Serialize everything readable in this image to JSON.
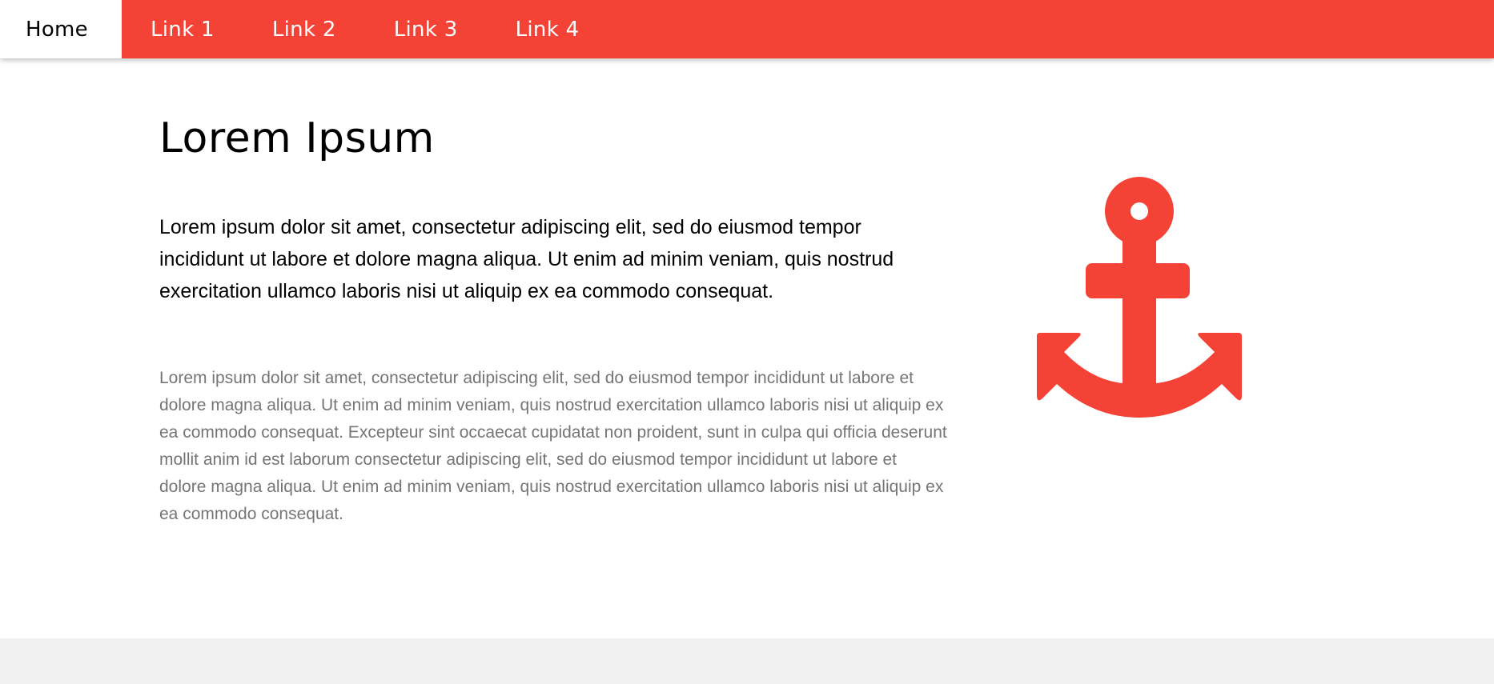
{
  "nav": {
    "items": [
      {
        "label": "Home",
        "active": true
      },
      {
        "label": "Link 1"
      },
      {
        "label": "Link 2"
      },
      {
        "label": "Link 3"
      },
      {
        "label": "Link 4"
      }
    ]
  },
  "main": {
    "title": "Lorem Ipsum",
    "lead": "Lorem ipsum dolor sit amet, consectetur adipiscing elit, sed do eiusmod tempor incididunt ut labore et dolore magna aliqua. Ut enim ad minim veniam, quis nostrud exercitation ullamco laboris nisi ut aliquip ex ea commodo consequat.",
    "body": "Lorem ipsum dolor sit amet, consectetur adipiscing elit, sed do eiusmod tempor incididunt ut labore et dolore magna aliqua. Ut enim ad minim veniam, quis nostrud exercitation ullamco laboris nisi ut aliquip ex ea commodo consequat. Excepteur sint occaecat cupidatat non proident, sunt in culpa qui officia deserunt mollit anim id est laborum consectetur adipiscing elit, sed do eiusmod tempor incididunt ut labore et dolore magna aliqua. Ut enim ad minim veniam, quis nostrud exercitation ullamco laboris nisi ut aliquip ex ea commodo consequat.",
    "icon": "anchor-icon"
  },
  "colors": {
    "accent": "#f44336",
    "text": "#000000",
    "muted": "#757575",
    "footer": "#f1f1f1"
  }
}
